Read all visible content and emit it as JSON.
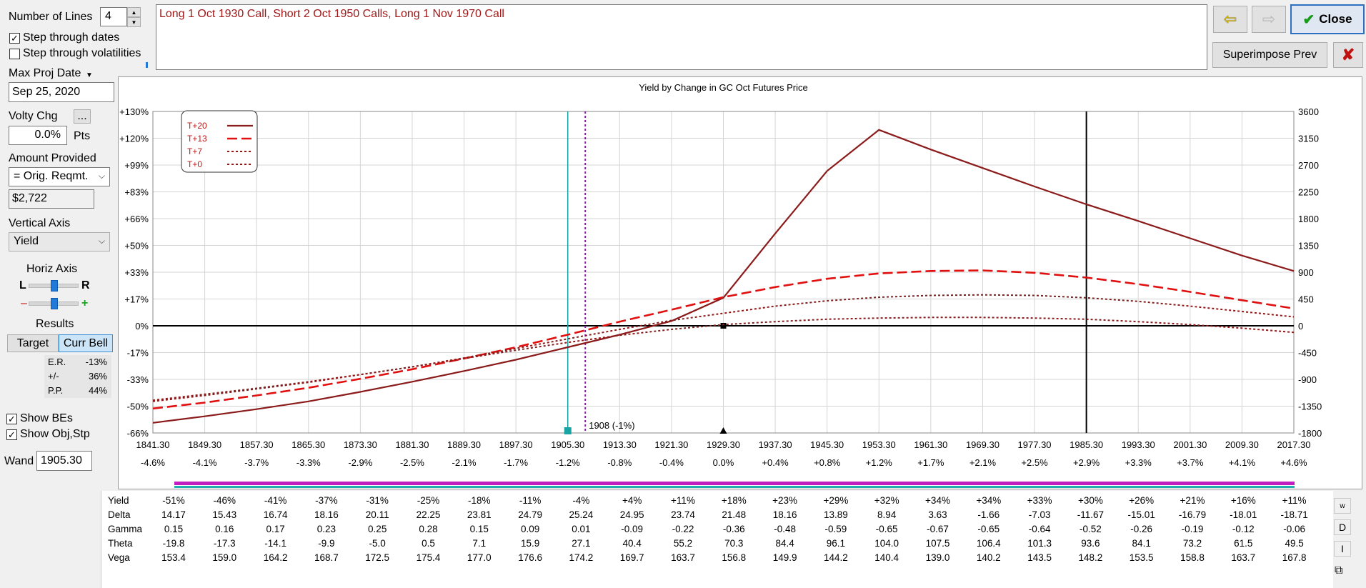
{
  "controls": {
    "number_of_lines_label": "Number of Lines",
    "number_of_lines_value": "4",
    "step_dates_label": "Step through dates",
    "step_dates_checked": true,
    "step_vols_label": "Step through volatilities",
    "step_vols_checked": false,
    "max_proj_date_label": "Max Proj Date",
    "max_proj_date_value": "Sep 25, 2020",
    "volty_chg_label": "Volty Chg",
    "volty_button": "...",
    "volty_value": "0.0%",
    "volty_unit": "Pts",
    "amount_provided_label": "Amount Provided",
    "amount_provided_value": "= Orig. Reqmt.",
    "amount_value": "$2,722",
    "vertical_axis_label": "Vertical Axis",
    "vertical_axis_value": "Yield",
    "horiz_axis_label": "Horiz Axis",
    "horiz_l": "L",
    "horiz_r": "R",
    "horiz_minus": "–",
    "horiz_plus": "+",
    "results_label": "Results",
    "target_button": "Target",
    "curr_bell_button": "Curr Bell",
    "er_label": "E.R.",
    "er_value": "-13%",
    "pm_label": "+/-",
    "pm_value": "36%",
    "pp_label": "P.P.",
    "pp_value": "44%",
    "show_bes_label": "Show BEs",
    "show_bes_checked": true,
    "show_obj_label": "Show Obj,Stp",
    "show_obj_checked": true,
    "wand_label": "Wand",
    "wand_value": "1905.30"
  },
  "strategy_text": "Long 1 Oct 1930 Call, Short 2 Oct 1950 Calls, Long 1 Nov 1970 Call",
  "toolbar": {
    "close_label": "Close",
    "superimpose_label": "Superimpose Prev",
    "close_x": "✘"
  },
  "chart_data": {
    "type": "line",
    "title": "Yield by Change in GC Oct Futures Price",
    "x": [
      1841.3,
      1849.3,
      1857.3,
      1865.3,
      1873.3,
      1881.3,
      1889.3,
      1897.3,
      1905.3,
      1913.3,
      1921.3,
      1929.3,
      1937.3,
      1945.3,
      1953.3,
      1961.3,
      1969.3,
      1977.3,
      1985.3,
      1993.3,
      2001.3,
      2009.3,
      2017.3
    ],
    "x_tick_labels": [
      "1841.30",
      "1849.30",
      "1857.30",
      "1865.30",
      "1873.30",
      "1881.30",
      "1889.30",
      "1897.30",
      "1905.30",
      "1913.30",
      "1921.30",
      "1929.30",
      "1937.30",
      "1945.30",
      "1953.30",
      "1961.30",
      "1969.30",
      "1977.30",
      "1985.30",
      "1993.30",
      "2001.30",
      "2009.30",
      "2017.30"
    ],
    "x_pct_labels": [
      "-4.6%",
      "-4.1%",
      "-3.7%",
      "-3.3%",
      "-2.9%",
      "-2.5%",
      "-2.1%",
      "-1.7%",
      "-1.2%",
      "-0.8%",
      "-0.4%",
      "0.0%",
      "+0.4%",
      "+0.8%",
      "+1.2%",
      "+1.7%",
      "+2.1%",
      "+2.5%",
      "+2.9%",
      "+3.3%",
      "+3.7%",
      "+4.1%",
      "+4.6%"
    ],
    "y_left_ticks": [
      "+130%",
      "+120%",
      "+99%",
      "+83%",
      "+66%",
      "+50%",
      "+33%",
      "+17%",
      "0%",
      "-17%",
      "-33%",
      "-50%",
      "-66%"
    ],
    "y_right_ticks": [
      "3600",
      "3150",
      "2700",
      "2250",
      "1800",
      "1350",
      "900",
      "450",
      "0",
      "-450",
      "-900",
      "-1350",
      "-1800"
    ],
    "y_right_range": [
      -1800,
      3600
    ],
    "x_range": [
      1841.3,
      2017.3
    ],
    "grid": true,
    "legend_position": "top-left",
    "series": [
      {
        "name": "T+20",
        "color": "#8b1a1a",
        "style": "solid",
        "values": [
          -1630,
          -1520,
          -1400,
          -1270,
          -1110,
          -940,
          -760,
          -570,
          -360,
          -150,
          80,
          470,
          1550,
          2600,
          3290,
          2960,
          2650,
          2340,
          2040,
          1760,
          1470,
          1180,
          920
        ]
      },
      {
        "name": "T+13",
        "color": "#e01010",
        "style": "dashed",
        "values": [
          -1390,
          -1290,
          -1170,
          -1040,
          -890,
          -730,
          -550,
          -360,
          -150,
          70,
          270,
          480,
          650,
          790,
          880,
          920,
          930,
          890,
          810,
          700,
          570,
          430,
          290
        ]
      },
      {
        "name": "T+7",
        "color": "#8b1a1a",
        "style": "dotted",
        "values": [
          -1270,
          -1170,
          -1060,
          -950,
          -820,
          -690,
          -540,
          -380,
          -220,
          -60,
          90,
          210,
          330,
          420,
          480,
          510,
          520,
          510,
          470,
          410,
          330,
          240,
          150
        ]
      },
      {
        "name": "T+0",
        "color": "#8b1a1a",
        "style": "dotted",
        "values": [
          -1250,
          -1150,
          -1050,
          -940,
          -820,
          -690,
          -550,
          -410,
          -280,
          -160,
          -60,
          20,
          70,
          110,
          130,
          140,
          140,
          130,
          110,
          70,
          20,
          -40,
          -110
        ]
      }
    ],
    "markers": {
      "wand_x": 1905.3,
      "breakeven_x": 1908,
      "breakeven_label": "1908 (-1%)",
      "current_x": 1929.3,
      "black_line_x": 1985.3
    },
    "colors": {
      "wand": "#1aa3a3",
      "breakeven": "#8b1aa8",
      "axis_zero": "#000000",
      "black_line": "#000000"
    }
  },
  "table": {
    "row_labels": [
      "Yield",
      "Delta",
      "Gamma",
      "Theta",
      "Vega"
    ],
    "rows": [
      [
        "-51%",
        "-46%",
        "-41%",
        "-37%",
        "-31%",
        "-25%",
        "-18%",
        "-11%",
        "-4%",
        "+4%",
        "+11%",
        "+18%",
        "+23%",
        "+29%",
        "+32%",
        "+34%",
        "+34%",
        "+33%",
        "+30%",
        "+26%",
        "+21%",
        "+16%",
        "+11%"
      ],
      [
        "14.17",
        "15.43",
        "16.74",
        "18.16",
        "20.11",
        "22.25",
        "23.81",
        "24.79",
        "25.24",
        "24.95",
        "23.74",
        "21.48",
        "18.16",
        "13.89",
        "8.94",
        "3.63",
        "-1.66",
        "-7.03",
        "-11.67",
        "-15.01",
        "-16.79",
        "-18.01",
        "-18.71"
      ],
      [
        "0.15",
        "0.16",
        "0.17",
        "0.23",
        "0.25",
        "0.28",
        "0.15",
        "0.09",
        "0.01",
        "-0.09",
        "-0.22",
        "-0.36",
        "-0.48",
        "-0.59",
        "-0.65",
        "-0.67",
        "-0.65",
        "-0.64",
        "-0.52",
        "-0.26",
        "-0.19",
        "-0.12",
        "-0.06"
      ],
      [
        "-19.8",
        "-17.3",
        "-14.1",
        "-9.9",
        "-5.0",
        "0.5",
        "7.1",
        "15.9",
        "27.1",
        "40.4",
        "55.2",
        "70.3",
        "84.4",
        "96.1",
        "104.0",
        "107.5",
        "106.4",
        "101.3",
        "93.6",
        "84.1",
        "73.2",
        "61.5",
        "49.5"
      ],
      [
        "153.4",
        "159.0",
        "164.2",
        "168.7",
        "172.5",
        "175.4",
        "177.0",
        "176.6",
        "174.2",
        "169.7",
        "163.7",
        "156.8",
        "149.9",
        "144.2",
        "140.4",
        "139.0",
        "140.2",
        "143.5",
        "148.2",
        "153.5",
        "158.8",
        "163.7",
        "167.8"
      ]
    ],
    "side_buttons": [
      "w",
      "D",
      "I"
    ]
  }
}
